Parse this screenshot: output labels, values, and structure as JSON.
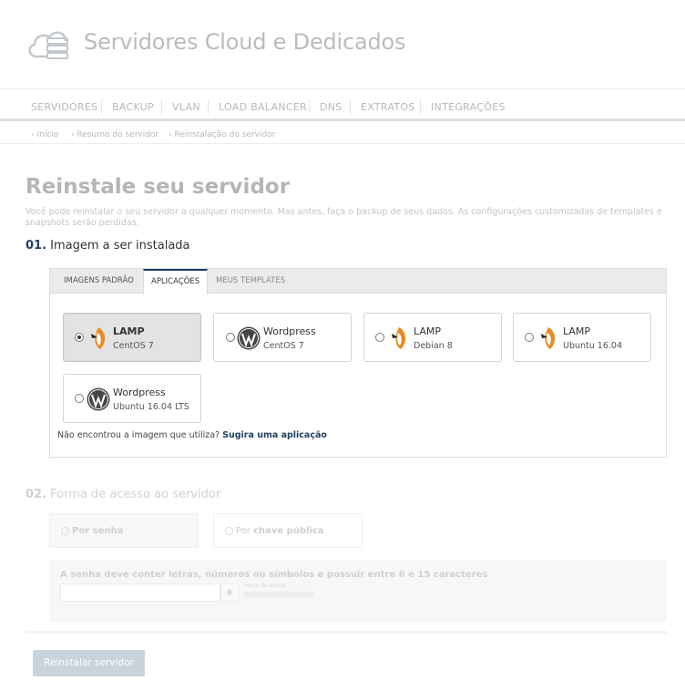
{
  "header": {
    "title": "Servidores Cloud e Dedicados",
    "logo_icon": "cloud-server-icon"
  },
  "nav": {
    "items": [
      "SERVIDORES",
      "BACKUP",
      "VLAN",
      "LOAD BALANCER",
      "DNS",
      "EXTRATOS",
      "INTEGRAÇÕES"
    ]
  },
  "breadcrumb": {
    "items": [
      "Início",
      "Resumo do servidor",
      "Reinstalação do servidor"
    ]
  },
  "page": {
    "title": "Reinstale seu servidor",
    "description": "Você pode reinstalar o seu servidor a qualquer momento. Mas antes, faça o backup de seus dados. As configurações customizadas de templates e snapshots serão perdidas."
  },
  "step1": {
    "number": "01.",
    "title": "Imagem a ser instalada",
    "tabs": [
      "IMAGENS PADRÃO",
      "APLICAÇÕES",
      "MEUS TEMPLATES"
    ],
    "active_tab": "APLICAÇÕES",
    "cards": [
      {
        "name": "LAMP",
        "os": "CentOS 7",
        "icon": "lamp-icon",
        "selected": true
      },
      {
        "name": "Wordpress",
        "os": "CentOS 7",
        "icon": "wordpress-icon",
        "selected": false
      },
      {
        "name": "LAMP",
        "os": "Debian 8",
        "icon": "lamp-icon",
        "selected": false
      },
      {
        "name": "LAMP",
        "os": "Ubuntu 16.04",
        "icon": "lamp-icon",
        "selected": false
      },
      {
        "name": "Wordpress",
        "os": "Ubuntu 16.04 LTS",
        "icon": "wordpress-icon",
        "selected": false
      }
    ],
    "suggest_text": "Não encontrou a imagem que utiliza?",
    "suggest_link": "Sugira uma aplicação"
  },
  "step2": {
    "number": "02.",
    "title": "Forma de acesso ao servidor",
    "options": [
      {
        "prefix": "",
        "label": "Por senha",
        "selected": true
      },
      {
        "prefix": "Por ",
        "label": "chave pública",
        "selected": false
      }
    ],
    "password_note": "A senha deve conter letras, números ou símbolos e possuir entre 6 e 15 caracteres",
    "password_value": "",
    "strength_label": "Força da senha"
  },
  "submit_label": "Reinstalar servidor",
  "colors": {
    "accent": "#1f3f5f",
    "lamp_orange": "#e98a22",
    "submit_bg": "#c9d3dc"
  }
}
